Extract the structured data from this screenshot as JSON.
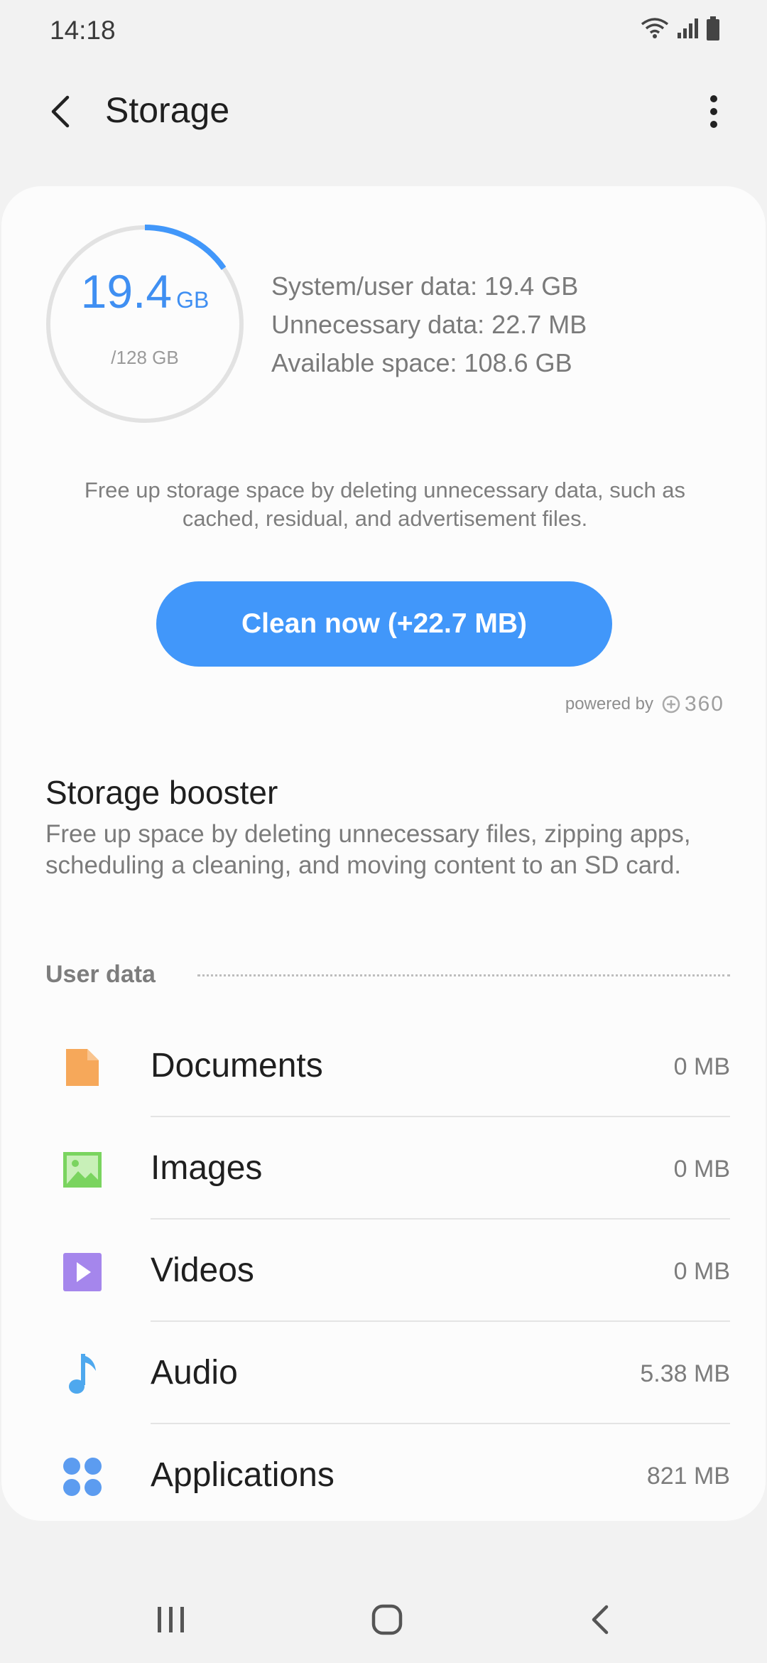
{
  "status_bar": {
    "time": "14:18"
  },
  "header": {
    "title": "Storage"
  },
  "summary": {
    "used_value": "19.4",
    "used_unit": "GB",
    "total": "/128 GB",
    "used_fraction": 0.152,
    "system_user_data": "System/user data: 19.4 GB",
    "unnecessary_data": "Unnecessary data: 22.7 MB",
    "available_space": "Available space: 108.6 GB",
    "description": "Free up storage space by deleting unnecessary data, such as cached, residual, and advertisement files.",
    "clean_button": "Clean now (+22.7 MB)",
    "powered_by": "powered by",
    "powered_logo": "360"
  },
  "booster": {
    "title": "Storage booster",
    "description": "Free up space by deleting unnecessary files, zipping apps, scheduling a cleaning, and moving content to an SD card."
  },
  "user_data": {
    "label": "User data",
    "items": [
      {
        "label": "Documents",
        "value": "0 MB",
        "icon": "document-icon",
        "color": "#f6a85a"
      },
      {
        "label": "Images",
        "value": "0 MB",
        "icon": "image-icon",
        "color": "#7ad45f"
      },
      {
        "label": "Videos",
        "value": "0 MB",
        "icon": "video-icon",
        "color": "#a586ec"
      },
      {
        "label": "Audio",
        "value": "5.38 MB",
        "icon": "music-note-icon",
        "color": "#4ea8ee"
      },
      {
        "label": "Applications",
        "value": "821 MB",
        "icon": "apps-grid-icon",
        "color": "#5c9cf0"
      }
    ]
  },
  "colors": {
    "accent": "#4197fa",
    "ring_track": "#e2e2e2"
  }
}
